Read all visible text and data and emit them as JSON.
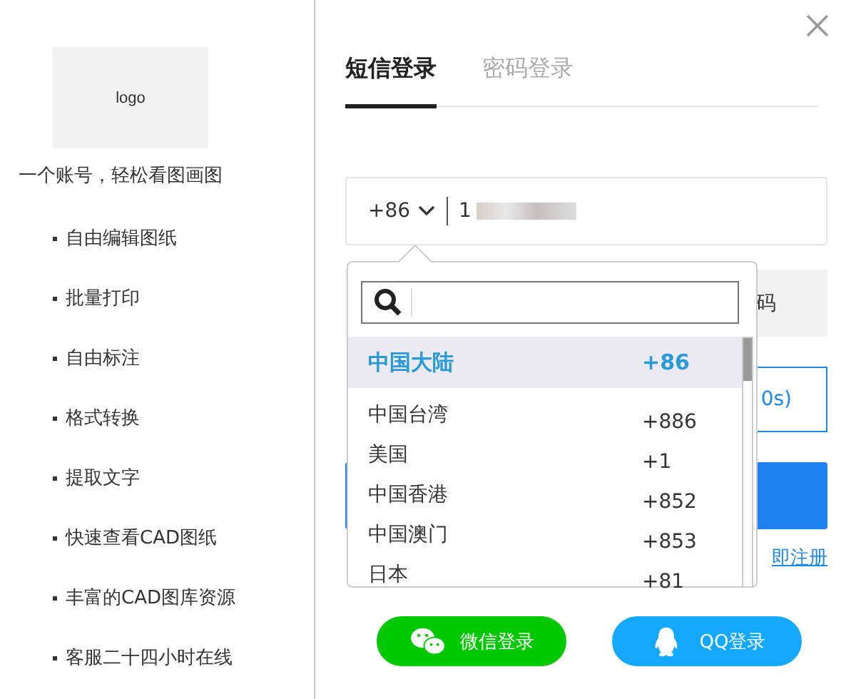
{
  "sidebar": {
    "logo": "logo",
    "tagline": "一个账号，轻松看图画图",
    "features": [
      "自由编辑图纸",
      "批量打印",
      "自由标注",
      "格式转换",
      "提取文字",
      "快速查看CAD图纸",
      "丰富的CAD图库资源",
      "客服二十四小时在线"
    ]
  },
  "tabs": [
    {
      "label": "短信登录",
      "selected": true
    },
    {
      "label": "密码登录",
      "selected": false
    }
  ],
  "phone_field": {
    "country_code": "+86",
    "value": "1"
  },
  "code_field": {
    "value": "码"
  },
  "code_button": {
    "label": "0s)"
  },
  "register_link": "即注册",
  "country_dropdown": {
    "countries": [
      {
        "name": "中国大陆",
        "code": "+86",
        "selected": true
      },
      {
        "name": "中国台湾",
        "code": "+886",
        "selected": false
      },
      {
        "name": "美国",
        "code": "+1",
        "selected": false
      },
      {
        "name": "中国香港",
        "code": "+852",
        "selected": false
      },
      {
        "name": "中国澳门",
        "code": "+853",
        "selected": false
      },
      {
        "name": "日本",
        "code": "+81",
        "selected": false
      }
    ]
  },
  "social_buttons": [
    {
      "kind": "wechat",
      "label": "微信登录"
    },
    {
      "kind": "qq",
      "label": "QQ登录"
    }
  ]
}
